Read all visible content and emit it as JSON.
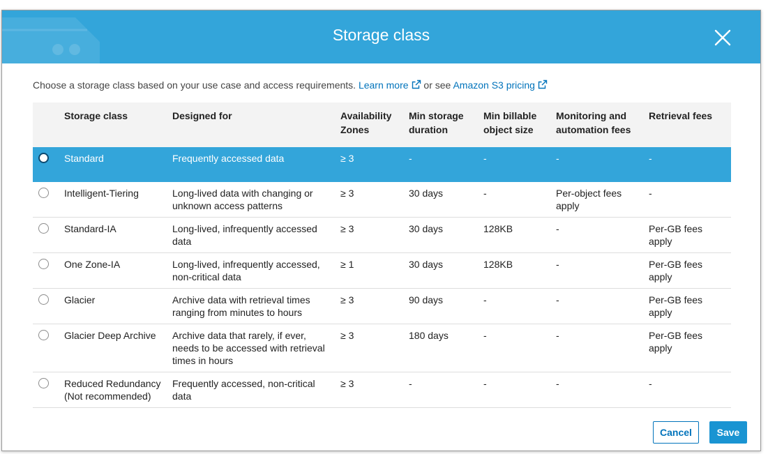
{
  "modal": {
    "title": "Storage class",
    "intro_text": "Choose a storage class based on your use case and access requirements.",
    "learn_more": "Learn more",
    "or_see": "or see",
    "pricing_link": "Amazon S3 pricing"
  },
  "table": {
    "headers": {
      "storage_class": "Storage class",
      "designed_for": "Designed for",
      "availability_zones": "Availability Zones",
      "min_storage_duration": "Min storage duration",
      "min_billable_size": "Min billable object size",
      "monitoring_fees": "Monitoring and automation fees",
      "retrieval_fees": "Retrieval fees"
    },
    "rows": [
      {
        "name": "Standard",
        "designed_for": "Frequently accessed data",
        "az": "≥ 3",
        "duration": "-",
        "size": "-",
        "monitoring": "-",
        "retrieval": "-"
      },
      {
        "name": "Intelligent-Tiering",
        "designed_for": "Long-lived data with changing or unknown access patterns",
        "az": "≥ 3",
        "duration": "30 days",
        "size": "-",
        "monitoring": "Per-object fees apply",
        "retrieval": "-"
      },
      {
        "name": "Standard-IA",
        "designed_for": "Long-lived, infrequently accessed data",
        "az": "≥ 3",
        "duration": "30 days",
        "size": "128KB",
        "monitoring": "-",
        "retrieval": "Per-GB fees apply"
      },
      {
        "name": "One Zone-IA",
        "designed_for": "Long-lived, infrequently accessed, non-critical data",
        "az": "≥ 1",
        "duration": "30 days",
        "size": "128KB",
        "monitoring": "-",
        "retrieval": "Per-GB fees apply"
      },
      {
        "name": "Glacier",
        "designed_for": "Archive data with retrieval times ranging from minutes to hours",
        "az": "≥ 3",
        "duration": "90 days",
        "size": "-",
        "monitoring": "-",
        "retrieval": "Per-GB fees apply"
      },
      {
        "name": "Glacier Deep Archive",
        "designed_for": "Archive data that rarely, if ever, needs to be accessed with retrieval times in hours",
        "az": "≥ 3",
        "duration": "180 days",
        "size": "-",
        "monitoring": "-",
        "retrieval": "Per-GB fees apply"
      },
      {
        "name": "Reduced Redundancy (Not recommended)",
        "designed_for": "Frequently accessed, non-critical data",
        "az": "≥ 3",
        "duration": "-",
        "size": "-",
        "monitoring": "-",
        "retrieval": "-"
      }
    ]
  },
  "buttons": {
    "cancel": "Cancel",
    "save": "Save"
  },
  "icons": {
    "close": "close-icon",
    "external_link": "external-link-icon",
    "radio": "radio-button"
  },
  "colors": {
    "header_bg": "#33a5da",
    "selected_row_bg": "#33a5da",
    "link": "#0073bb",
    "save_button": "#1a94d2"
  }
}
